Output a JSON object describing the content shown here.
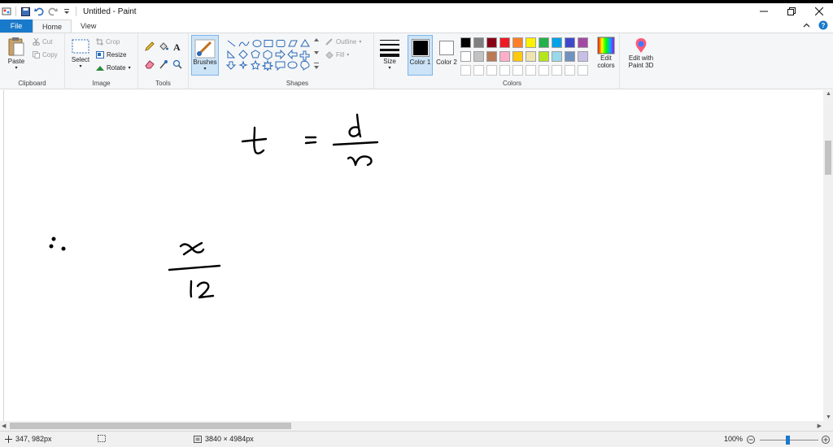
{
  "window": {
    "title": "Untitled - Paint"
  },
  "tabs": {
    "file": "File",
    "home": "Home",
    "view": "View"
  },
  "clipboard": {
    "paste": "Paste",
    "cut": "Cut",
    "copy": "Copy",
    "label": "Clipboard"
  },
  "image": {
    "select": "Select",
    "crop": "Crop",
    "resize": "Resize",
    "rotate": "Rotate",
    "label": "Image"
  },
  "tools": {
    "label": "Tools",
    "brushes": "Brushes"
  },
  "shapes": {
    "label": "Shapes",
    "outline": "Outline",
    "fill": "Fill"
  },
  "size": {
    "label": "Size"
  },
  "colors": {
    "color1": "Color 1",
    "color2": "Color 2",
    "label": "Colors",
    "edit_colors": "Edit colors",
    "paint3d": "Edit with Paint 3D",
    "color1_value": "#000000",
    "color2_value": "#ffffff",
    "palette_row1": [
      "#000000",
      "#7f7f7f",
      "#880015",
      "#ed1c24",
      "#ff7f27",
      "#fff200",
      "#22b14c",
      "#00a2e8",
      "#3f48cc",
      "#a349a4"
    ],
    "palette_row2": [
      "#ffffff",
      "#c3c3c3",
      "#b97a57",
      "#ffaec9",
      "#ffc90e",
      "#efe4b0",
      "#b5e61d",
      "#99d9ea",
      "#7092be",
      "#c8bfe7"
    ]
  },
  "status": {
    "cursor": "347, 982px",
    "dimensions": "3840 × 4984px",
    "zoom": "100%"
  },
  "accent": "#1979ca"
}
